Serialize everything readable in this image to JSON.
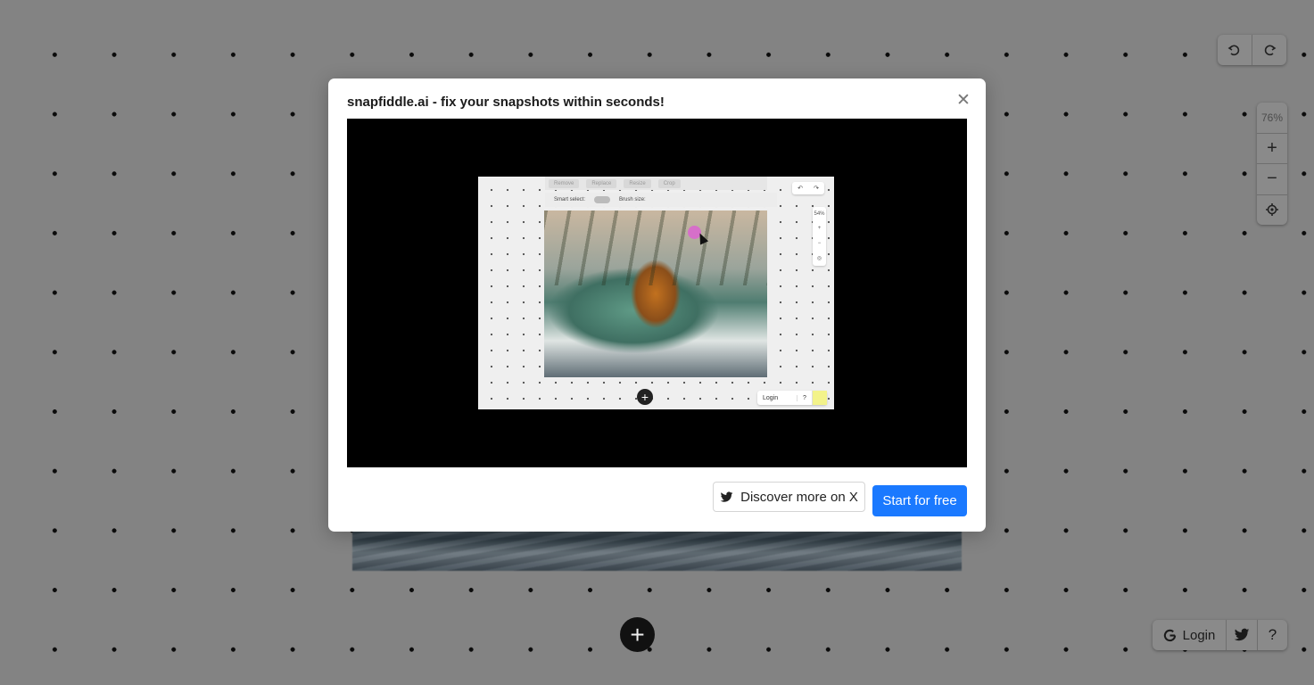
{
  "history": {
    "undo_icon": "undo-icon",
    "redo_icon": "redo-icon"
  },
  "zoom": {
    "level": "76%",
    "zoom_in": "+",
    "zoom_out": "−",
    "recenter_icon": "crosshair-icon"
  },
  "add_button": {
    "label": "+"
  },
  "bottombar": {
    "login_label": "Login",
    "help_label": "?"
  },
  "modal": {
    "title": "snapfiddle.ai - fix your snapshots within seconds!",
    "close_label": "✕",
    "discover_label": "Discover more on X",
    "start_label": "Start for free"
  },
  "preview": {
    "toolbar_items": [
      "Remove",
      "Replace",
      "Resize",
      "Crop"
    ],
    "smart_select": "Smart select:",
    "brush_size": "Brush size:",
    "zoom_level": "54%",
    "login": "Login",
    "help": "?"
  },
  "colors": {
    "primary_button": "#1a79ff",
    "canvas_bg": "#838383"
  }
}
